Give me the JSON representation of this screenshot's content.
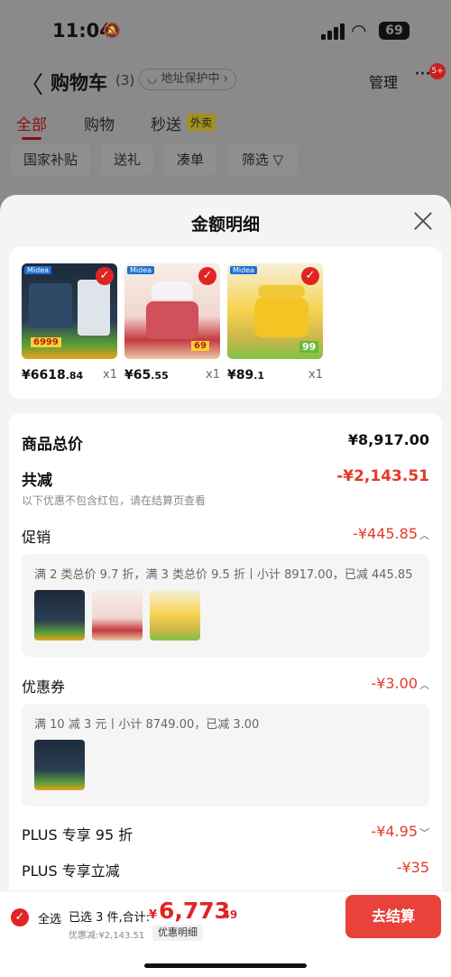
{
  "status": {
    "time": "11:04",
    "battery": "69"
  },
  "nav": {
    "back": "〈",
    "title": "购物车",
    "count": "(3)",
    "addr_protect": "◡ 地址保护中 ›",
    "manage": "管理",
    "more": "···",
    "more_badge": "5+"
  },
  "tabs": [
    {
      "label": "全部"
    },
    {
      "label": "购物"
    },
    {
      "label": "秒送"
    }
  ],
  "waimai": "外卖",
  "chips": [
    {
      "label": "国家补贴"
    },
    {
      "label": "送礼"
    },
    {
      "label": "凑单"
    },
    {
      "label": "筛选 ▽"
    }
  ],
  "sheet": {
    "title": "金额明细"
  },
  "products": [
    {
      "price_main": "¥6618",
      "price_dec": ".84",
      "qty": "x1",
      "img_label": "Midea",
      "img_tag": "6999"
    },
    {
      "price_main": "¥65",
      "price_dec": ".55",
      "qty": "x1",
      "img_label": "Midea",
      "img_tag": "69"
    },
    {
      "price_main": "¥89",
      "price_dec": ".1",
      "qty": "x1",
      "img_label": "Midea",
      "img_tag": "99"
    }
  ],
  "summary": {
    "goods_total_label": "商品总价",
    "goods_total_value": "¥8,917.00",
    "reduce_label": "共减",
    "reduce_value": "-¥2,143.51",
    "reduce_note": "以下优惠不包含红包，请在结算页查看",
    "promo_label": "促销",
    "promo_value": "-¥445.85",
    "promo_desc": "满 2 类总价 9.7 折，满 3 类总价 9.5 折丨小计 8917.00，已减 445.85",
    "coupon_label": "优惠券",
    "coupon_value": "-¥3.00",
    "coupon_desc": "满 10 减 3 元丨小计 8749.00，已减 3.00",
    "plus95_label": "PLUS 专享 95 折",
    "plus95_value": "-¥4.95",
    "plus_reduce_label": "PLUS 专享立减",
    "plus_reduce_value": "-¥35"
  },
  "bottom": {
    "select_all": "全选",
    "selected": "已选 3 件,合计:",
    "currency": "¥",
    "total_main": "6,773",
    "total_dec": ".49",
    "saved": "优惠减:¥2,143.51",
    "detail": "优惠明细",
    "checkout": "去结算"
  },
  "colors": {
    "accent": "#e02424",
    "checkout_bg": "#e9423a",
    "discount": "#e33a2a"
  }
}
